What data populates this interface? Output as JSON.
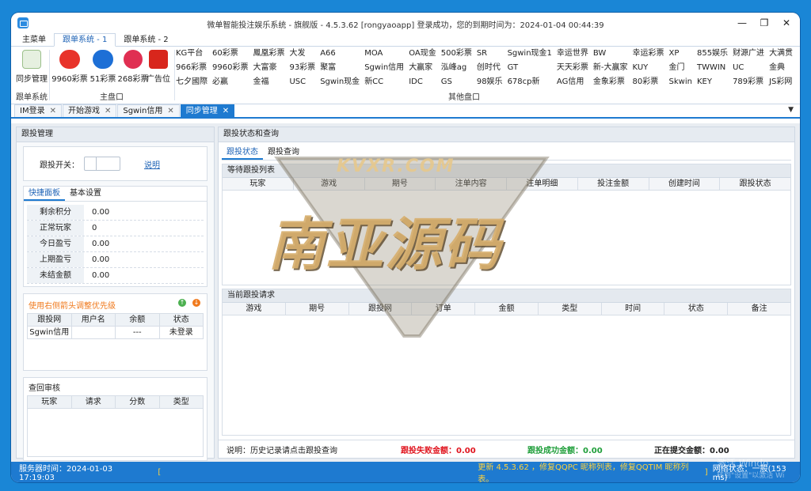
{
  "window": {
    "title": "微单智能投注娱乐系统 - 旗舰版 - 4.5.3.62   [rongyaoapp] 登录成功，您的到期时间为：2024-01-04 00:44:39",
    "controls": [
      "—",
      "❐",
      "✕"
    ]
  },
  "ribbon_tabs": [
    "主菜单",
    "跟单系统 - 1",
    "跟单系统 - 2"
  ],
  "ribbon": {
    "sync_label": "同步管理",
    "group_follow_label": "跟单系统",
    "main_buttons": [
      "9960彩票",
      "51彩票",
      "268彩票",
      "广告位"
    ],
    "group_main_label": "主盘口",
    "other_rows": [
      [
        "KG平台",
        "60彩票",
        "鳳凰彩票",
        "大发",
        "A66",
        "MOA",
        "OA现金",
        "500彩票",
        "SR",
        "Sgwin现金1",
        "幸运世界",
        "BW",
        "幸运彩票",
        "XP",
        "855娱乐",
        "财源广进",
        "大满贯"
      ],
      [
        "966彩票",
        "9960彩票",
        "大富豪",
        "93彩票",
        "聚富",
        "Sgwin信用",
        "大赢家",
        "泓峰ag",
        "创时代",
        "GT",
        "天天彩票",
        "新-大赢家",
        "KUY",
        "金门",
        "TWWIN",
        "UC",
        "金典"
      ],
      [
        "七夕國際",
        "必赢",
        "金福",
        "USC",
        "Sgwin现金",
        "新CC",
        "IDC",
        "GS",
        "98娱乐",
        "678cp新",
        "AG信用",
        "金象彩票",
        "80彩票",
        "Skwin",
        "KEY",
        "789彩票",
        "JS彩网"
      ]
    ],
    "group_other_label": "其他盘口"
  },
  "doc_tabs": [
    {
      "label": "IM登录"
    },
    {
      "label": "开始游戏"
    },
    {
      "label": "Sgwin信用"
    },
    {
      "label": "同步管理"
    }
  ],
  "left": {
    "title": "跟投管理",
    "switch_label": "跟投开关：",
    "explain_link": "说明",
    "tabs": [
      "快捷面板",
      "基本设置"
    ],
    "stats": [
      {
        "k": "剩余积分",
        "v": "0.00"
      },
      {
        "k": "正常玩家",
        "v": "0"
      },
      {
        "k": "今日盈亏",
        "v": "0.00"
      },
      {
        "k": "上期盈亏",
        "v": "0.00"
      },
      {
        "k": "未结金额",
        "v": "0.00"
      }
    ],
    "priority_title": "使用右侧箭头调整优先级",
    "priority_cols": [
      "跟投网",
      "用户名",
      "余额",
      "状态"
    ],
    "priority_row": [
      "Sgwin信用",
      "",
      "---",
      "未登录"
    ],
    "review_title": "查回审核",
    "review_cols": [
      "玩家",
      "请求",
      "分数",
      "类型"
    ]
  },
  "right": {
    "title": "跟投状态和查询",
    "tabs": [
      "跟投状态",
      "跟投查询"
    ],
    "waiting_title": "等待跟投列表",
    "waiting_cols": [
      "玩家",
      "游戏",
      "期号",
      "注单内容",
      "注单明细",
      "投注金额",
      "创建时间",
      "跟投状态"
    ],
    "current_title": "当前跟投请求",
    "current_cols": [
      "游戏",
      "期号",
      "跟投网",
      "订单",
      "金额",
      "类型",
      "时间",
      "状态",
      "备注"
    ],
    "note": "说明：历史记录请点击跟投查询",
    "fail_label": "跟投失败金额：0.00",
    "success_label": "跟投成功金额：0.00",
    "submitting_label": "正在提交金额：0.00"
  },
  "statusbar": {
    "server_time": "服务器时间：2024-01-03 17:19:03",
    "bracket": "[",
    "update": "更新 4.5.3.62 ，修复QQPC 昵称列表，修复QQTIM 昵称列表。",
    "bracket2": "]",
    "network": "网络状态：一般(153 ms)",
    "activate1": "激活 Windo",
    "activate2": "转到\"设置\"以激活 Wi"
  },
  "watermark": {
    "brand": "KVXR.COM",
    "big_text": "南亚源码"
  },
  "colors": {
    "accent": "#1e7ad0",
    "fail": "#e0141e",
    "success": "#1f9e3a",
    "status_text": "#ffd23c"
  }
}
